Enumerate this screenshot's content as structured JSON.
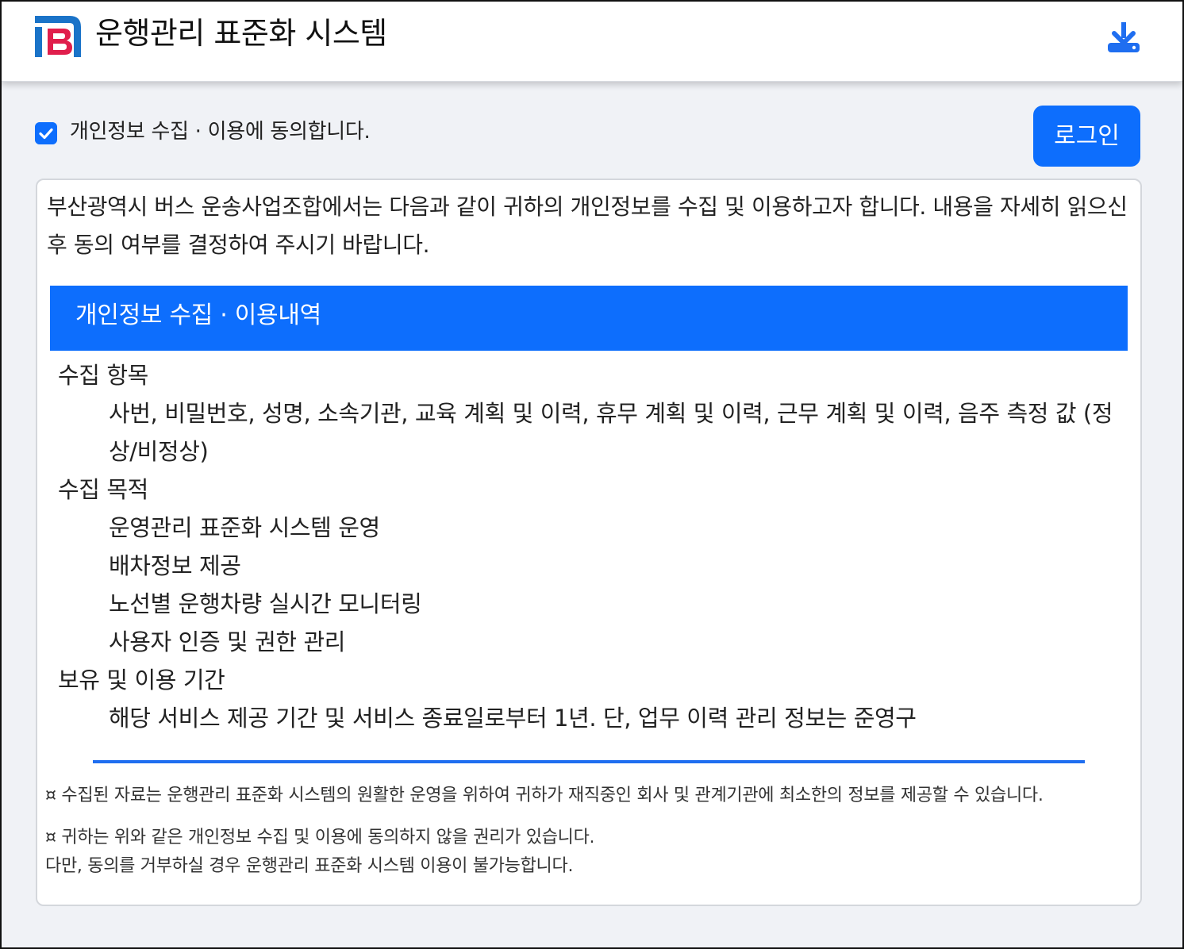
{
  "header": {
    "app_title": "운행관리 표준화 시스템",
    "logo_icon": "ib-logo-icon",
    "download_icon": "download-icon"
  },
  "consent": {
    "checked": true,
    "label": "개인정보 수집 · 이용에 동의합니다."
  },
  "login_button_label": "로그인",
  "panel": {
    "intro": "부산광역시 버스 운송사업조합에서는 다음과 같이 귀하의 개인정보를 수집 및 이용하고자 합니다. 내용을 자세히 읽으신 후 동의 여부를 결정하여 주시기 바랍니다.",
    "section_title": "개인정보 수집 · 이용내역",
    "terms": [
      {
        "term": "수집 항목",
        "details": [
          "사번, 비밀번호, 성명, 소속기관, 교육 계획 및 이력, 휴무 계획 및 이력, 근무 계획 및 이력, 음주 측정 값 (정상/비정상)"
        ]
      },
      {
        "term": "수집 목적",
        "details": [
          "운영관리 표준화 시스템 운영",
          "배차정보 제공",
          "노선별 운행차량 실시간 모니터링",
          "사용자 인증 및 권한 관리"
        ]
      },
      {
        "term": "보유 및 이용 기간",
        "details": [
          "해당 서비스 제공 기간 및 서비스 종료일로부터 1년. 단, 업무 이력 관리 정보는 준영구"
        ]
      }
    ],
    "notices": [
      "¤ 수집된 자료는 운행관리 표준화 시스템의 원활한 운영을 위하여 귀하가 재직중인 회사 및 관계기관에 최소한의 정보를 제공할 수 있습니다.",
      "¤ 귀하는 위와 같은 개인정보 수집 및 이용에 동의하지 않을 권리가 있습니다.",
      "다만, 동의를 거부하실 경우 운행관리 표준화 시스템 이용이 불가능합니다."
    ]
  },
  "colors": {
    "accent": "#0d6efd",
    "logo_blue": "#1a73c8",
    "logo_red": "#e01e4c",
    "background": "#f0f2f6"
  }
}
